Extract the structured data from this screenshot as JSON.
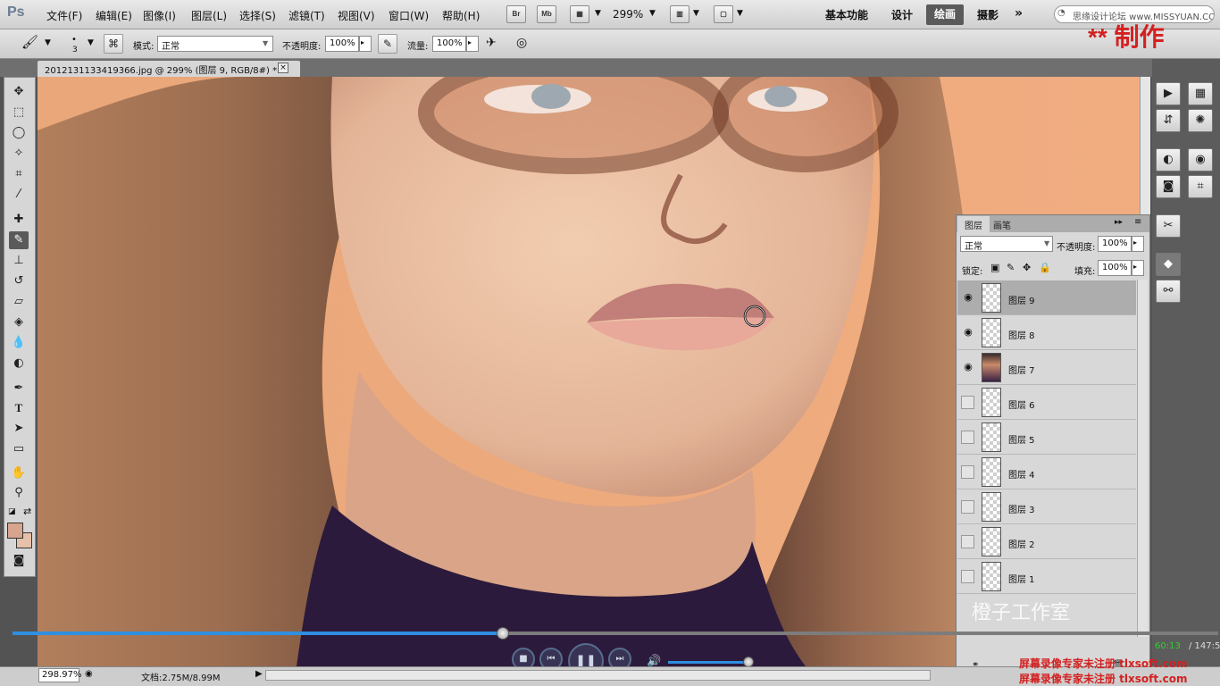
{
  "app": {
    "logo": "Ps",
    "menu": [
      "文件(F)",
      "编辑(E)",
      "图像(I)",
      "图层(L)",
      "选择(S)",
      "滤镜(T)",
      "视图(V)",
      "窗口(W)",
      "帮助(H)"
    ],
    "bridge_label": "Br",
    "minibridge_label": "Mb",
    "zoom": "299%",
    "workspaces": [
      "基本功能",
      "设计",
      "绘画",
      "摄影"
    ],
    "active_workspace": "绘画",
    "search_placeholder": "思缘设计论坛 www.MISSYUAN.COM"
  },
  "options": {
    "brush_size": "3",
    "mode_label": "模式:",
    "mode_value": "正常",
    "opacity_label": "不透明度:",
    "opacity_value": "100%",
    "flow_label": "流量:",
    "flow_value": "100%"
  },
  "overlay": {
    "title": "** 制作",
    "studio": "橙子工作室",
    "reg_line1": "屏幕录像专家未注册 tlxsoft.com",
    "reg_line2": "屏幕录像专家未注册 tlxsoft.com",
    "time_current": "60:13",
    "time_total": "/ 147:57"
  },
  "document": {
    "tab_title": "2012131133419366.jpg @ 299% (图层 9, RGB/8#) *",
    "close_label": "×"
  },
  "layers_panel": {
    "tabs": [
      "图层",
      "画笔"
    ],
    "blend_mode": "正常",
    "opacity_label": "不透明度:",
    "opacity_value": "100%",
    "lock_label": "锁定:",
    "fill_label": "填充:",
    "fill_value": "100%",
    "layers": [
      {
        "name": "图层 9",
        "visible": true,
        "selected": true,
        "photo": false
      },
      {
        "name": "图层 8",
        "visible": true,
        "selected": false,
        "photo": false
      },
      {
        "name": "图层 7",
        "visible": true,
        "selected": false,
        "photo": true
      },
      {
        "name": "图层 6",
        "visible": false,
        "selected": false,
        "photo": false
      },
      {
        "name": "图层 5",
        "visible": false,
        "selected": false,
        "photo": false
      },
      {
        "name": "图层 4",
        "visible": false,
        "selected": false,
        "photo": false
      },
      {
        "name": "图层 3",
        "visible": false,
        "selected": false,
        "photo": false
      },
      {
        "name": "图层 2",
        "visible": false,
        "selected": false,
        "photo": false
      },
      {
        "name": "图层 1",
        "visible": false,
        "selected": false,
        "photo": false
      }
    ]
  },
  "status": {
    "zoom": "298.97%",
    "doc_size": "文档:2.75M/8.99M"
  },
  "player": {
    "progress": 0.407
  },
  "colors": {
    "foreground": "#d7a58e",
    "background": "#e6c0a8",
    "accent": "#2f8fe0"
  }
}
